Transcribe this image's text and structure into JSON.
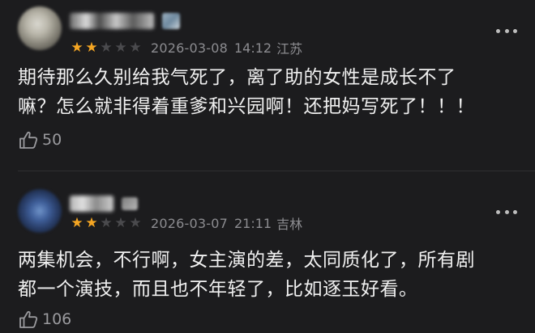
{
  "comments": [
    {
      "rating": 2,
      "max_rating": 5,
      "date": "2026-03-08",
      "time": "14:12",
      "location": "江苏",
      "text_lines": [
        "期待那么久别给我气死了，离了助的女性是成长不了",
        "嘛？怎么就非得着重爹和兴园啊！还把妈写死了！！！"
      ],
      "likes": "50"
    },
    {
      "rating": 2,
      "max_rating": 5,
      "date": "2026-03-07",
      "time": "21:11",
      "location": "吉林",
      "text_lines": [
        "两集机会，不行啊，女主演的差，太同质化了，所有剧",
        "都一个演技，而且也不年轻了，比如逐玉好看。"
      ],
      "likes": "106"
    }
  ],
  "colors": {
    "background": "#1c1c1e",
    "star_on": "#f5a623",
    "star_off": "#4a4a4d",
    "meta_text": "#8c8c90",
    "body_text": "#f0f0f0"
  },
  "icons": {
    "like": "thumbs-up-icon",
    "more": "more-dots-icon",
    "star": "star-icon"
  }
}
